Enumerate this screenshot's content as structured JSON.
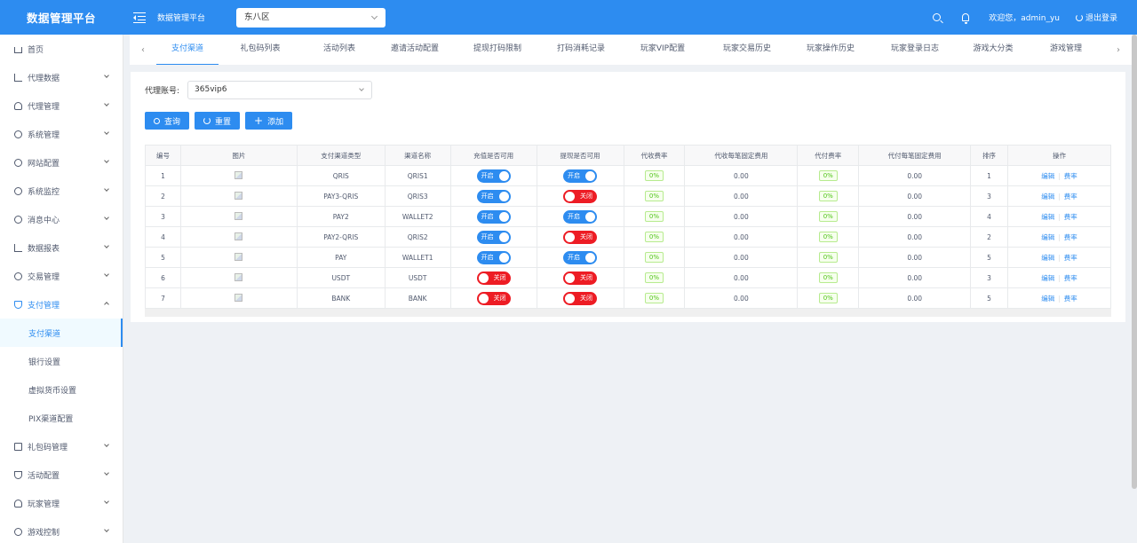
{
  "header": {
    "brand": "数据管理平台",
    "title": "数据管理平台",
    "timezone": "东八区",
    "welcome": "欢迎您，admin_yu",
    "logout": "退出登录"
  },
  "sidebar": {
    "items": [
      {
        "label": "首页",
        "icon": "home-icon"
      },
      {
        "label": "代理数据",
        "icon": "chart-icon"
      },
      {
        "label": "代理管理",
        "icon": "user-icon"
      },
      {
        "label": "系统管理",
        "icon": "gear-icon"
      },
      {
        "label": "网站配置",
        "icon": "globe-icon"
      },
      {
        "label": "系统监控",
        "icon": "monitor-icon"
      },
      {
        "label": "消息中心",
        "icon": "message-icon"
      },
      {
        "label": "数据报表",
        "icon": "chart-icon"
      },
      {
        "label": "交易管理",
        "icon": "dollar-icon"
      },
      {
        "label": "支付管理",
        "icon": "shield-icon"
      },
      {
        "label": "支付渠道"
      },
      {
        "label": "银行设置"
      },
      {
        "label": "虚拟货币设置"
      },
      {
        "label": "PIX渠道配置"
      },
      {
        "label": "礼包码管理",
        "icon": "gift-icon"
      },
      {
        "label": "活动配置",
        "icon": "trophy-icon"
      },
      {
        "label": "玩家管理",
        "icon": "users-icon"
      },
      {
        "label": "游戏控制",
        "icon": "gear-icon"
      }
    ]
  },
  "tabs": [
    "支付渠道",
    "礼包码列表",
    "活动列表",
    "邀请活动配置",
    "提现打码限制",
    "打码消耗记录",
    "玩家VIP配置",
    "玩家交易历史",
    "玩家操作历史",
    "玩家登录日志",
    "游戏大分类",
    "游戏管理"
  ],
  "filter": {
    "label": "代理账号:",
    "value": "365vip6"
  },
  "buttons": {
    "query": "查询",
    "reset": "重置",
    "add": "添加"
  },
  "table": {
    "headers": [
      "编号",
      "图片",
      "支付渠道类型",
      "渠道名称",
      "充值是否可用",
      "提现是否可用",
      "代收费率",
      "代收每笔固定费用",
      "代付费率",
      "代付每笔固定费用",
      "排序",
      "操作"
    ],
    "on_label": "开启",
    "off_label": "关闭",
    "edit_label": "编辑",
    "rate_label": "费率",
    "rows": [
      {
        "id": "1",
        "type": "QRIS",
        "name": "QRIS1",
        "deposit": true,
        "withdraw": true,
        "collect_rate": "0%",
        "collect_fee": "0.00",
        "pay_rate": "0%",
        "pay_fee": "0.00",
        "sort": "1"
      },
      {
        "id": "2",
        "type": "PAY3-QRIS",
        "name": "QRIS3",
        "deposit": true,
        "withdraw": false,
        "collect_rate": "0%",
        "collect_fee": "0.00",
        "pay_rate": "0%",
        "pay_fee": "0.00",
        "sort": "3"
      },
      {
        "id": "3",
        "type": "PAY2",
        "name": "WALLET2",
        "deposit": true,
        "withdraw": true,
        "collect_rate": "0%",
        "collect_fee": "0.00",
        "pay_rate": "0%",
        "pay_fee": "0.00",
        "sort": "4"
      },
      {
        "id": "4",
        "type": "PAY2-QRIS",
        "name": "QRIS2",
        "deposit": true,
        "withdraw": false,
        "collect_rate": "0%",
        "collect_fee": "0.00",
        "pay_rate": "0%",
        "pay_fee": "0.00",
        "sort": "2"
      },
      {
        "id": "5",
        "type": "PAY",
        "name": "WALLET1",
        "deposit": true,
        "withdraw": true,
        "collect_rate": "0%",
        "collect_fee": "0.00",
        "pay_rate": "0%",
        "pay_fee": "0.00",
        "sort": "5"
      },
      {
        "id": "6",
        "type": "USDT",
        "name": "USDT",
        "deposit": false,
        "withdraw": false,
        "collect_rate": "0%",
        "collect_fee": "0.00",
        "pay_rate": "0%",
        "pay_fee": "0.00",
        "sort": "3"
      },
      {
        "id": "7",
        "type": "BANK",
        "name": "BANK",
        "deposit": false,
        "withdraw": false,
        "collect_rate": "0%",
        "collect_fee": "0.00",
        "pay_rate": "0%",
        "pay_fee": "0.00",
        "sort": "5"
      }
    ]
  },
  "colors": {
    "primary": "#2d8cf0",
    "danger": "#ed1c24",
    "success": "#52c41a"
  }
}
